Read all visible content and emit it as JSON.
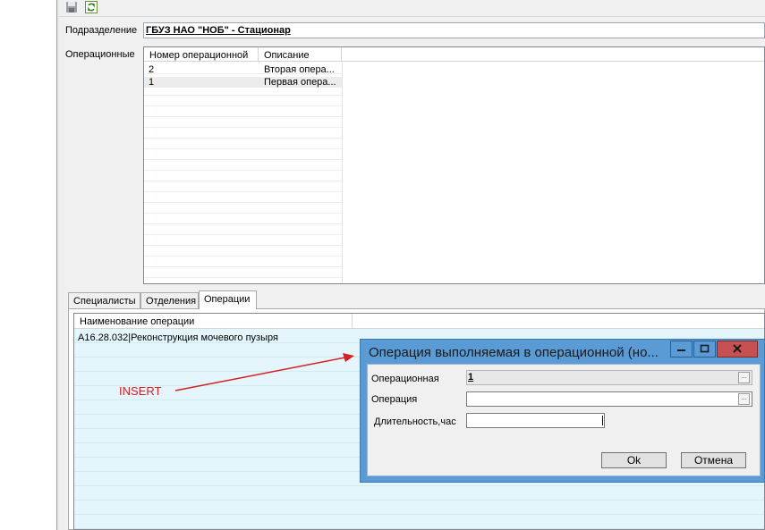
{
  "form": {
    "subdivision_label": "Подразделение",
    "subdivision_value": "ГБУЗ НАО \"НОБ\" - Стационар",
    "operating_label": "Операционные"
  },
  "operating_grid": {
    "columns": [
      "Номер операционной",
      "Описание"
    ],
    "rows": [
      {
        "number": "2",
        "description": "Вторая опера..."
      },
      {
        "number": "1",
        "description": "Первая опера..."
      }
    ]
  },
  "tabs": [
    "Специалисты",
    "Отделения",
    "Операции"
  ],
  "operations_grid": {
    "column": "Наименование операции",
    "rows": [
      "A16.28.032|Реконструкция мочевого пузыря"
    ]
  },
  "annotation": {
    "text": "INSERT",
    "color": "#d32020"
  },
  "dialog": {
    "title": "Операция выполняемая в операционной (но...",
    "operating_label": "Операционная",
    "operating_value": "1",
    "operation_label": "Операция",
    "operation_value": "",
    "duration_label": "Длительность,час",
    "duration_value": "",
    "ok_label": "Ok",
    "cancel_label": "Отмена",
    "title_color": "#5b9bd5",
    "close_color": "#c75050"
  }
}
